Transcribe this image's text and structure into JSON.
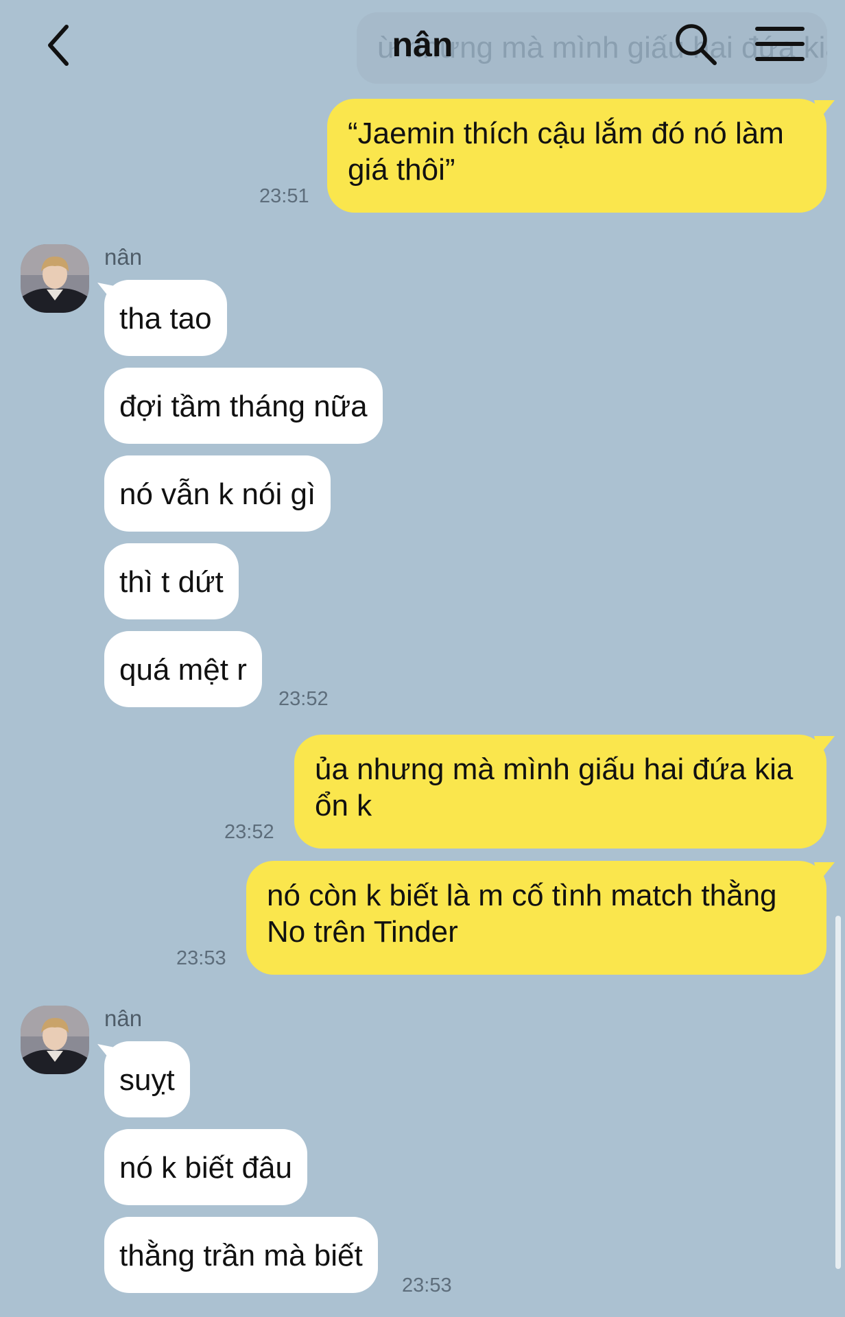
{
  "header": {
    "title": "nân",
    "ghost_preview": "ừ nhưng mà mình giấu hai đứa kia ổn k"
  },
  "messages": [
    {
      "text": "“Jaemin thích cậu lắm đó nó làm giá thôi”",
      "time": "23:51"
    },
    {
      "sender": "nân"
    },
    {
      "text": "tha tao"
    },
    {
      "text": "đợi tầm tháng nữa"
    },
    {
      "text": "nó vẫn k nói gì"
    },
    {
      "text": "thì t dứt"
    },
    {
      "text": "quá mệt r",
      "time": "23:52"
    },
    {
      "text": "ủa nhưng mà mình giấu hai đứa kia ổn k",
      "time": "23:52"
    },
    {
      "text": "nó còn k biết là m cố tình match thằng No trên Tinder",
      "time": "23:53"
    },
    {
      "sender": "nân"
    },
    {
      "text": "suỵt"
    },
    {
      "text": "nó k biết đâu"
    },
    {
      "text": "thằng trần mà biết",
      "time": "23:53"
    }
  ]
}
